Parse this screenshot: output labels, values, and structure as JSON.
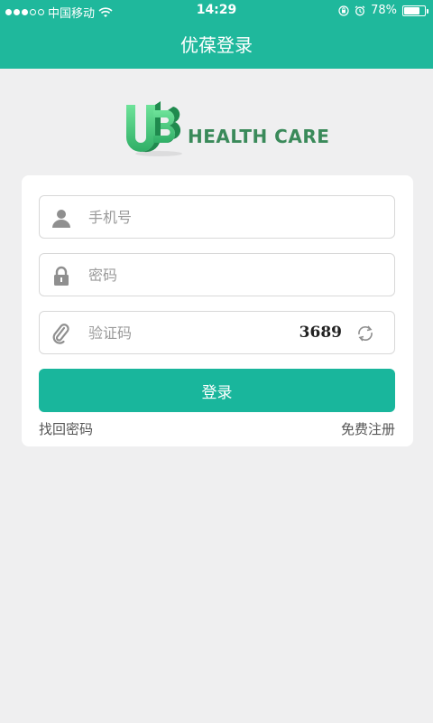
{
  "status_bar": {
    "carrier": "中国移动",
    "time": "14:29",
    "battery": "78%",
    "battery_level": 0.78,
    "signal_bars_filled": 3,
    "signal_bars_total": 5,
    "icons": [
      "wifi-icon",
      "orientation-lock-icon",
      "alarm-icon",
      "battery-icon"
    ]
  },
  "header": {
    "title": "优葆登录",
    "background": "#1fb89c"
  },
  "logo": {
    "mark": "UB",
    "text": "HEALTH CARE"
  },
  "form": {
    "phone_placeholder": "手机号",
    "password_placeholder": "密码",
    "captcha_placeholder": "验证码",
    "captcha_code": "3689",
    "login_label": "登录",
    "forgot_label": "找回密码",
    "register_label": "免费注册",
    "icons": {
      "phone": "user-icon",
      "password": "lock-icon",
      "captcha": "paperclip-icon",
      "refresh": "refresh-icon"
    },
    "accent": "#19b69c"
  }
}
